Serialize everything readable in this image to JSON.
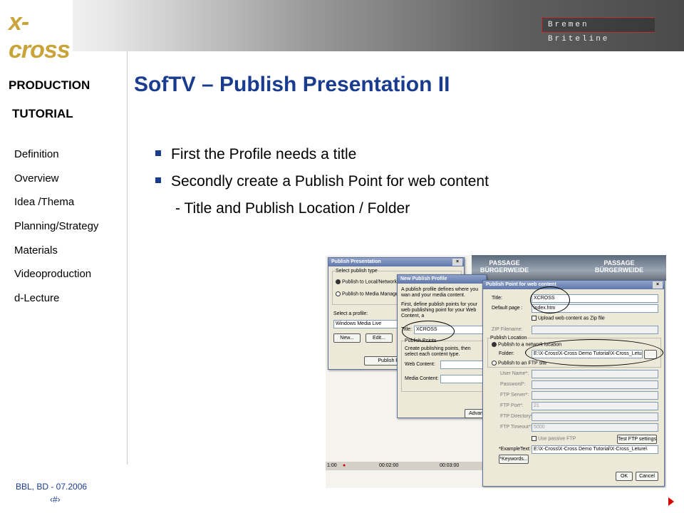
{
  "header": {
    "logo_text": "x-cross",
    "brand": "Bremen Briteline"
  },
  "sidebar": {
    "title_line1": "PRODUCTION",
    "title_line2": "TUTORIAL",
    "items": [
      {
        "label": "Definition"
      },
      {
        "label": "Overview"
      },
      {
        "label": "Idea /Thema"
      },
      {
        "label": "Planning/Strategy"
      },
      {
        "label": "Materials"
      },
      {
        "label": "Videoproduction"
      },
      {
        "label": "d-Lecture"
      }
    ]
  },
  "slide": {
    "title": "SofTV – Publish Presentation II",
    "bullets": [
      "First the Profile needs a title",
      "Secondly create a Publish Point for web content"
    ],
    "sub": "- Title and Publish Location / Folder"
  },
  "footer": {
    "credit": "BBL, BD - 07.2006",
    "page": "‹#›"
  },
  "screenshot": {
    "photo_text1": "PASSAGE BÜRGERWEIDE",
    "photo_text2": "PASSAGE BÜRGERWEIDE",
    "timeline": {
      "t1": "1:00",
      "t2": "00:02:00",
      "t3": "00:03:00"
    },
    "win1": {
      "title": "Publish Presentation",
      "group": "Select publish type",
      "radio1": "Publish to Local/Network pa",
      "radio2": "Publish to Media Manageme",
      "profile_label": "Select a profile:",
      "profile_value": "Windows Media Live",
      "new_btn": "New...",
      "edit_btn": "Edit...",
      "publish_btn": "Publish Prese"
    },
    "win2": {
      "title": "New Publish Profile",
      "desc1": "A publish profile defines where you wan and your media content.",
      "desc2": "First, define publish points for your web publishing point for your Web Content, a",
      "title_label": "Title:",
      "title_value": "XCROSS",
      "group": "Publish Points",
      "group_desc": "Create publishing points, then select each content type.",
      "web_label": "Web Content:",
      "media_label": "Media Content:",
      "adv_btn": "Advan"
    },
    "win3": {
      "title": "Publish Point for web content",
      "title_label": "Title:",
      "title_value": "XCROSS",
      "default_label": "Default page :",
      "default_value": "index.htm",
      "zip_check": "Upload web content as Zip file",
      "zip_label": "ZIP Filename:",
      "group": "Publish Location",
      "radio1": "Publish to a network location",
      "folder_label": "Folder:",
      "folder_value": "E:\\X-Cross\\X-Cross Demo Tutorial\\X-Cross_Leture\\",
      "radio2": "Publish to an FTP site",
      "user_label": "User Name*:",
      "pass_label": "Password*:",
      "server_label": "FTP Server*:",
      "port_label": "FTP Port*:",
      "port_value": "21",
      "dir_label": "FTP Directory*:",
      "timeout_label": "FTP Timeout*:",
      "timeout_value": "5000",
      "passive_check": "Use passive FTP",
      "test_btn": "Test FTP settings",
      "example_label": "*ExampleText:",
      "example_value": "E:\\X-Cross\\X-Cross Demo Tutorial\\X-Cross_Leture\\",
      "keywords_btn": "*Keywords...",
      "ok_btn": "OK",
      "cancel_btn": "Cancel"
    }
  }
}
